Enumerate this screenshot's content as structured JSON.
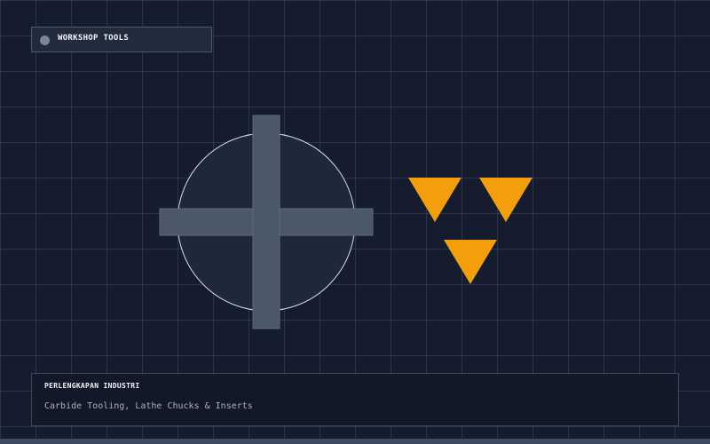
{
  "header": {
    "badge_label": "WORKSHOP TOOLS"
  },
  "info_panel": {
    "title": "PERLENGKAPAN INDUSTRI",
    "subtitle": "Carbide Tooling, Lathe Chucks & Inserts"
  },
  "illustration": {
    "chuck_icon": "lathe-chuck-icon",
    "insert_icon": "carbide-insert-icon",
    "insert_count": 3
  },
  "colors": {
    "background": "#141c2e",
    "chuck_body": "#1f2838",
    "chuck_outline": "#d7dde6",
    "jaw_bar": "#4a5869",
    "insert": "#f59e0b"
  }
}
